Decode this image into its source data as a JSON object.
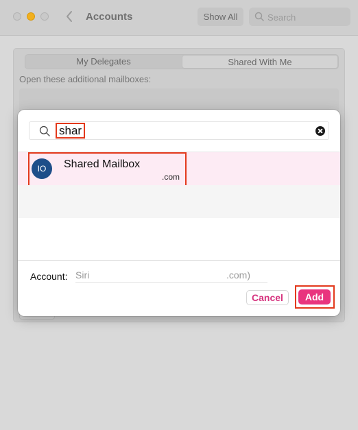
{
  "window": {
    "title": "Accounts",
    "show_all_label": "Show All",
    "search_placeholder": "Search"
  },
  "tabs": [
    {
      "label": "My Delegates",
      "selected": false
    },
    {
      "label": "Shared With Me",
      "selected": true
    }
  ],
  "panel": {
    "instruction": "Open these additional mailboxes:"
  },
  "dialog": {
    "search_query": "shar",
    "results": [
      {
        "initials": "IO",
        "name": "Shared Mailbox",
        "email": ".com",
        "selected": true
      }
    ],
    "account_label": "Account:",
    "account_name": "Siri",
    "account_domain": ".com)",
    "cancel_label": "Cancel",
    "add_label": "Add"
  },
  "colors": {
    "accent": "#e9347e",
    "cancel_text": "#d6337e",
    "highlight_outline": "#e3391c",
    "selected_row": "#fdebf4",
    "avatar": "#1d4e89"
  }
}
